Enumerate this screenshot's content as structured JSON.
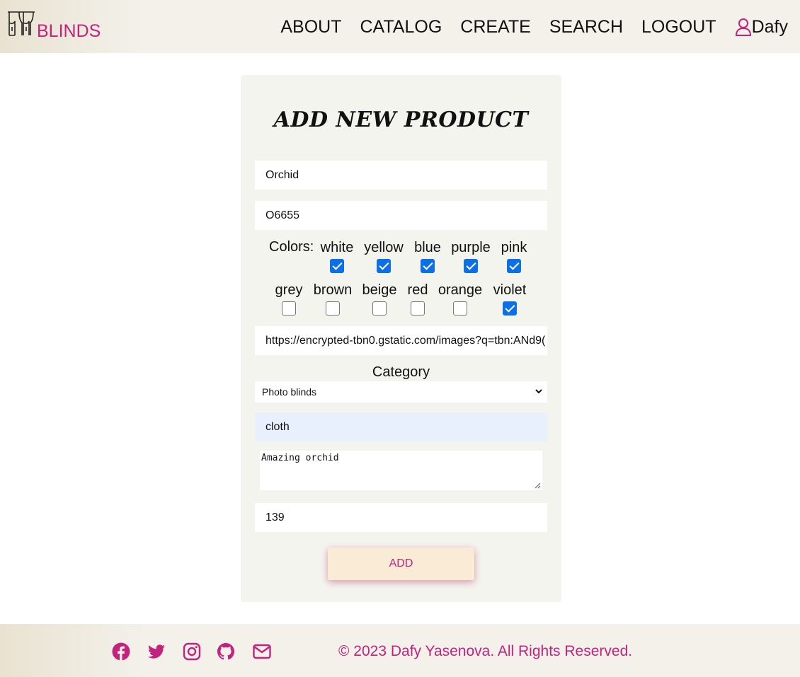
{
  "brand": {
    "name": "BLINDS",
    "accent": "#c4237d",
    "logo_icon": "curtains-icon"
  },
  "nav": {
    "links": [
      "ABOUT",
      "CATALOG",
      "CREATE",
      "SEARCH",
      "LOGOUT"
    ],
    "user": {
      "name": "Dafy",
      "icon": "user-icon"
    }
  },
  "form": {
    "title": "ADD NEW PRODUCT",
    "name_value": "Orchid",
    "code_value": "O6655",
    "colors_label": "Colors:",
    "colors": [
      {
        "name": "white",
        "checked": true
      },
      {
        "name": "yellow",
        "checked": true
      },
      {
        "name": "blue",
        "checked": true
      },
      {
        "name": "purple",
        "checked": true
      },
      {
        "name": "pink",
        "checked": true
      },
      {
        "name": "grey",
        "checked": false
      },
      {
        "name": "brown",
        "checked": false
      },
      {
        "name": "beige",
        "checked": false
      },
      {
        "name": "red",
        "checked": false
      },
      {
        "name": "orange",
        "checked": false
      },
      {
        "name": "violet",
        "checked": true
      }
    ],
    "image_url_value": "https://encrypted-tbn0.gstatic.com/images?q=tbn:ANd9(",
    "category_label": "Category",
    "category_selected": "Photo blinds",
    "material_value": "cloth",
    "description_value": "Amazing orchid",
    "price_value": "139",
    "submit_label": "ADD"
  },
  "footer": {
    "social_icons": [
      "facebook-icon",
      "twitter-icon",
      "instagram-icon",
      "github-icon",
      "mail-icon"
    ],
    "copyright": "© 2023 Dafy Yasenova. All Rights Reserved."
  }
}
